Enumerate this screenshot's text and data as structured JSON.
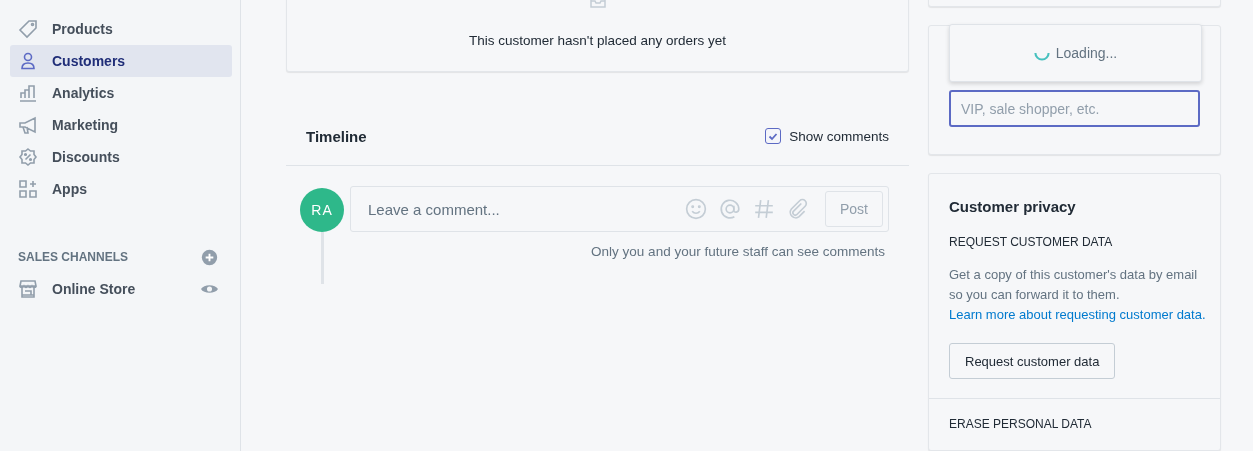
{
  "sidebar": {
    "items": [
      {
        "label": "Products",
        "kind": "tag",
        "selected": false
      },
      {
        "label": "Customers",
        "kind": "person",
        "selected": true
      },
      {
        "label": "Analytics",
        "kind": "chart",
        "selected": false
      },
      {
        "label": "Marketing",
        "kind": "megaphone",
        "selected": false
      },
      {
        "label": "Discounts",
        "kind": "discount",
        "selected": false
      },
      {
        "label": "Apps",
        "kind": "apps",
        "selected": false
      }
    ],
    "sales_channels": {
      "heading": "SALES CHANNELS",
      "items": [
        {
          "label": "Online Store"
        }
      ]
    }
  },
  "orders_card": {
    "empty_text": "This customer hasn't placed any orders yet"
  },
  "timeline": {
    "title": "Timeline",
    "show_comments": {
      "label": "Show comments",
      "checked": true
    },
    "avatar": {
      "initials": "RA"
    },
    "comment": {
      "placeholder": "Leave a comment...",
      "post_button": "Post"
    },
    "note": "Only you and your future staff can see comments"
  },
  "tags_card": {
    "loading": "Loading...",
    "input": {
      "placeholder": "VIP, sale shopper, etc."
    }
  },
  "privacy_card": {
    "title": "Customer privacy",
    "sections": [
      {
        "heading": "REQUEST CUSTOMER DATA",
        "text": "Get a copy of this customer's data by email so you can forward it to them.",
        "link": "Learn more about requesting customer data.",
        "button": "Request customer data"
      },
      {
        "heading": "ERASE PERSONAL DATA"
      }
    ]
  }
}
